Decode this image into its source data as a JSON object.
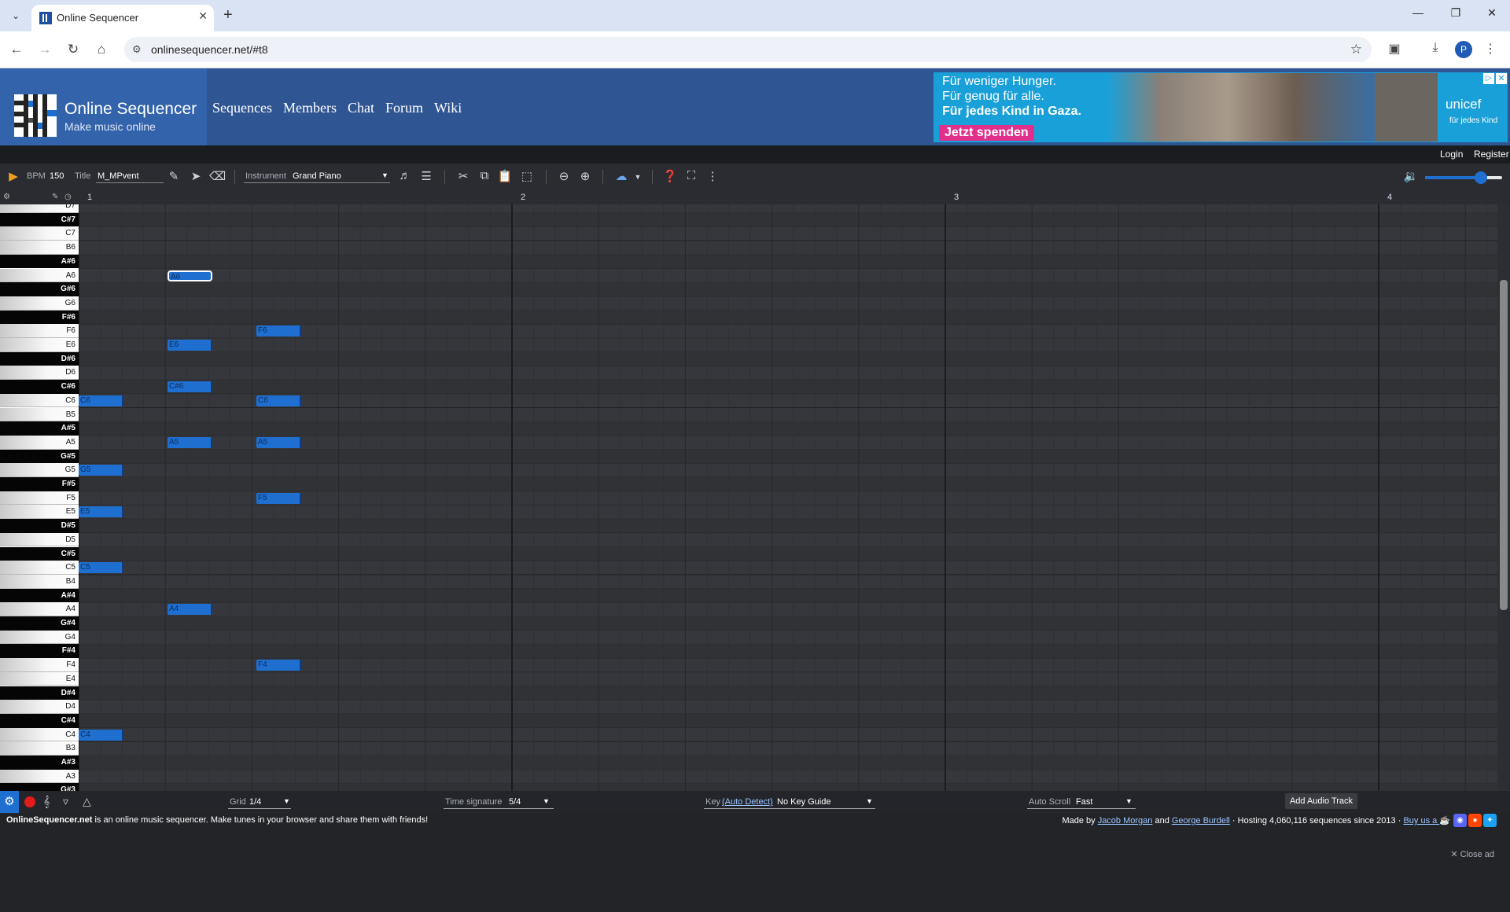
{
  "browser": {
    "tab_title": "Online Sequencer",
    "url": "onlinesequencer.net/#t8",
    "profile_initial": "P"
  },
  "site": {
    "name": "Online Sequencer",
    "tagline": "Make music online",
    "nav": [
      "Sequences",
      "Members",
      "Chat",
      "Forum",
      "Wiki"
    ],
    "login": "Login",
    "register": "Register"
  },
  "ad": {
    "line1": "Für weniger Hunger.",
    "line2": "Für genug für alle.",
    "line3": "Für jedes Kind in Gaza.",
    "cta": "Jetzt spenden",
    "brand": "unicef",
    "brand_sub": "für jedes Kind"
  },
  "toolbar": {
    "bpm_label": "BPM",
    "bpm_value": "150",
    "title_label": "Title",
    "title_value": "M_MPvent",
    "instrument_label": "Instrument",
    "instrument_value": "Grand Piano",
    "volume": 0.72
  },
  "timeline": {
    "bars": [
      "1",
      "2",
      "3",
      "4"
    ]
  },
  "piano_keys": [
    "D7",
    "C#7",
    "C7",
    "B6",
    "A#6",
    "A6",
    "G#6",
    "G6",
    "F#6",
    "F6",
    "E6",
    "D#6",
    "D6",
    "C#6",
    "C6",
    "B5",
    "A#5",
    "A5",
    "G#5",
    "G5",
    "F#5",
    "F5",
    "E5",
    "D#5",
    "D5",
    "C#5",
    "C5",
    "B4",
    "A#4",
    "A4",
    "G#4",
    "G4",
    "F#4",
    "F4",
    "E4",
    "D#4",
    "D4",
    "C#4",
    "C4",
    "B3",
    "A#3",
    "A3",
    "G#3"
  ],
  "notes": [
    {
      "pitch": "A6",
      "beat": 0.5,
      "length": 0.25,
      "selected": true
    },
    {
      "pitch": "F6",
      "beat": 1.0,
      "length": 0.25
    },
    {
      "pitch": "E6",
      "beat": 0.5,
      "length": 0.25
    },
    {
      "pitch": "C#6",
      "beat": 0.5,
      "length": 0.25
    },
    {
      "pitch": "C6",
      "beat": 0.0,
      "length": 0.25
    },
    {
      "pitch": "C6",
      "beat": 1.0,
      "length": 0.25
    },
    {
      "pitch": "A5",
      "beat": 0.5,
      "length": 0.25
    },
    {
      "pitch": "A5",
      "beat": 1.0,
      "length": 0.25
    },
    {
      "pitch": "G5",
      "beat": 0.0,
      "length": 0.25
    },
    {
      "pitch": "F5",
      "beat": 1.0,
      "length": 0.25
    },
    {
      "pitch": "E5",
      "beat": 0.0,
      "length": 0.25
    },
    {
      "pitch": "C5",
      "beat": 0.0,
      "length": 0.25
    },
    {
      "pitch": "A4",
      "beat": 0.5,
      "length": 0.25
    },
    {
      "pitch": "F4",
      "beat": 1.0,
      "length": 0.25
    },
    {
      "pitch": "C4",
      "beat": 0.0,
      "length": 0.25
    }
  ],
  "bottom": {
    "grid_label": "Grid",
    "grid_value": "1/4",
    "time_sig_label": "Time signature",
    "time_sig_value": "5/4",
    "key_label": "Key",
    "key_autodetect": "(Auto Detect)",
    "key_value": "No Key Guide",
    "autoscroll_label": "Auto Scroll",
    "autoscroll_value": "Fast",
    "add_audio_track": "Add Audio Track"
  },
  "footer": {
    "site_bold": "OnlineSequencer.net",
    "desc": " is an online music sequencer. Make tunes in your browser and share them with friends!",
    "made_by": "Made by ",
    "author1": "Jacob Morgan",
    "and": " and ",
    "author2": "George Burdell",
    "hosting": " · Hosting 4,060,116 sequences since 2013 · ",
    "buy": "Buy us a ",
    "close_ad": "✕ Close ad"
  },
  "colors": {
    "note": "#1f6fd0",
    "header": "#2f5593",
    "logo_bg": "#3363ab",
    "grid_bg": "#35373c"
  }
}
